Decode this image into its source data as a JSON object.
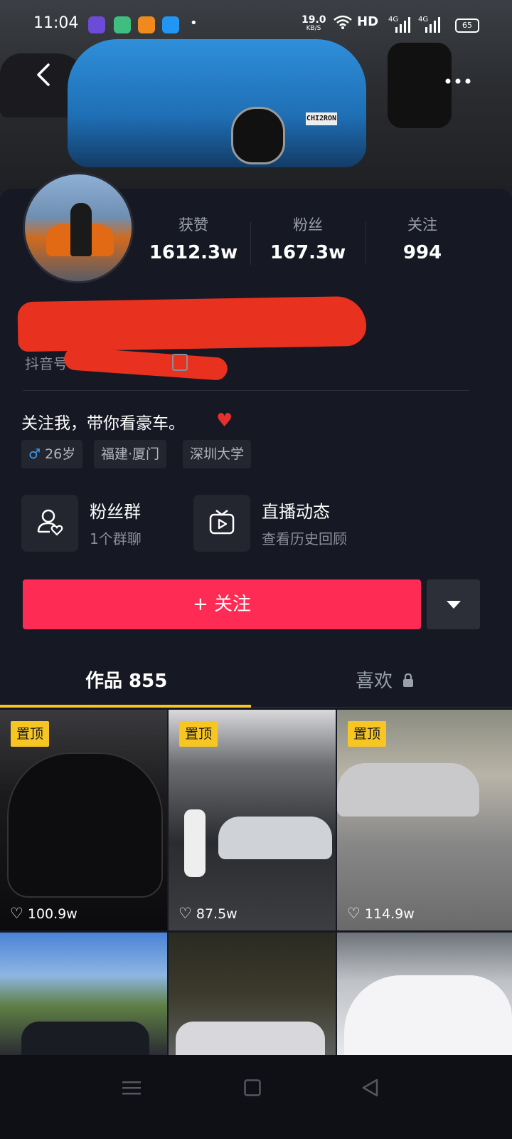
{
  "status_bar": {
    "time": "11:04",
    "net_speed_value": "19.0",
    "net_speed_unit": "KB/S",
    "network": "HD",
    "signal1": "4G",
    "signal2": "4G",
    "battery": "65"
  },
  "header": {
    "plate_text": "CHI2RON"
  },
  "stats": [
    {
      "label": "获赞",
      "value": "1612.3w"
    },
    {
      "label": "粉丝",
      "value": "167.3w"
    },
    {
      "label": "关注",
      "value": "994"
    }
  ],
  "profile": {
    "douyin_id_label": "抖音号",
    "bio": "关注我，带你看豪车。",
    "tags": [
      {
        "icon": "male-icon",
        "text": "26岁"
      },
      {
        "text": "福建·厦门"
      },
      {
        "text": "深圳大学"
      }
    ]
  },
  "features": [
    {
      "icon": "fan-group-icon",
      "title": "粉丝群",
      "subtitle": "1个群聊"
    },
    {
      "icon": "live-tv-icon",
      "title": "直播动态",
      "subtitle": "查看历史回顾"
    }
  ],
  "follow_button": {
    "label": "+ 关注"
  },
  "tabs": {
    "works_label": "作品 855",
    "likes_label": "喜欢"
  },
  "grid": [
    {
      "pinned": "置顶",
      "likes": "100.9w"
    },
    {
      "pinned": "置顶",
      "likes": "87.5w"
    },
    {
      "pinned": "置顶",
      "likes": "114.9w"
    },
    {
      "pinned": "",
      "likes": ""
    },
    {
      "pinned": "",
      "likes": ""
    },
    {
      "pinned": "",
      "likes": ""
    }
  ],
  "colors": {
    "background": "#161823",
    "accent_follow": "#fe2c55",
    "tab_underline": "#f7c623",
    "pin_badge": "#f7c623"
  }
}
